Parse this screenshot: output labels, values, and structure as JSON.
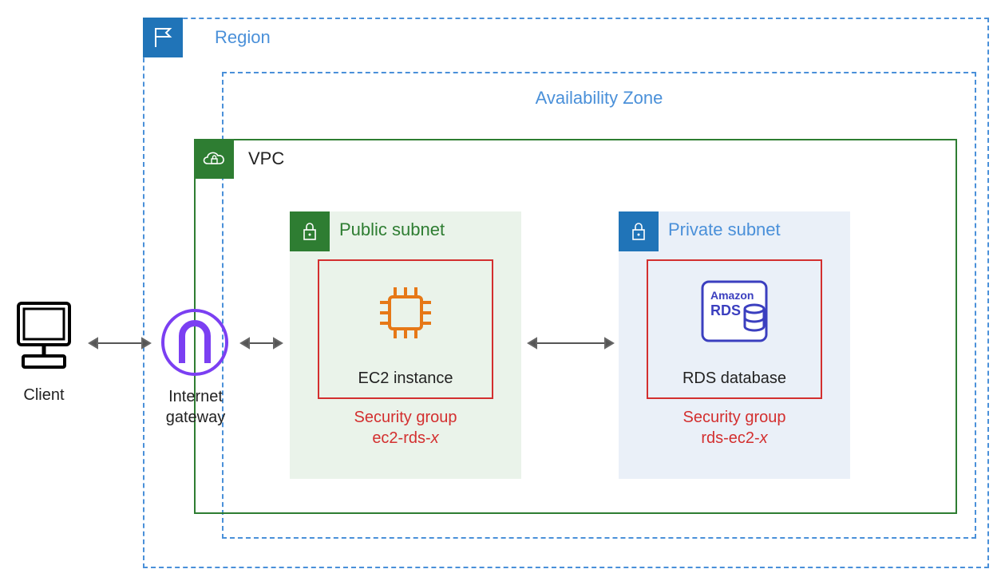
{
  "region": {
    "label": "Region"
  },
  "az": {
    "label": "Availability Zone"
  },
  "vpc": {
    "label": "VPC"
  },
  "public_subnet": {
    "label": "Public subnet"
  },
  "private_subnet": {
    "label": "Private subnet"
  },
  "ec2": {
    "caption": "EC2 instance",
    "sg_line1": "Security group",
    "sg_line2_prefix": "ec2-rds-",
    "sg_line2_var": "x"
  },
  "rds": {
    "caption": "RDS database",
    "logo_line1": "Amazon",
    "logo_line2": "RDS",
    "sg_line1": "Security group",
    "sg_line2_prefix": "rds-ec2-",
    "sg_line2_var": "x"
  },
  "client": {
    "label": "Client"
  },
  "igw": {
    "line1": "Internet",
    "line2": "gateway"
  }
}
